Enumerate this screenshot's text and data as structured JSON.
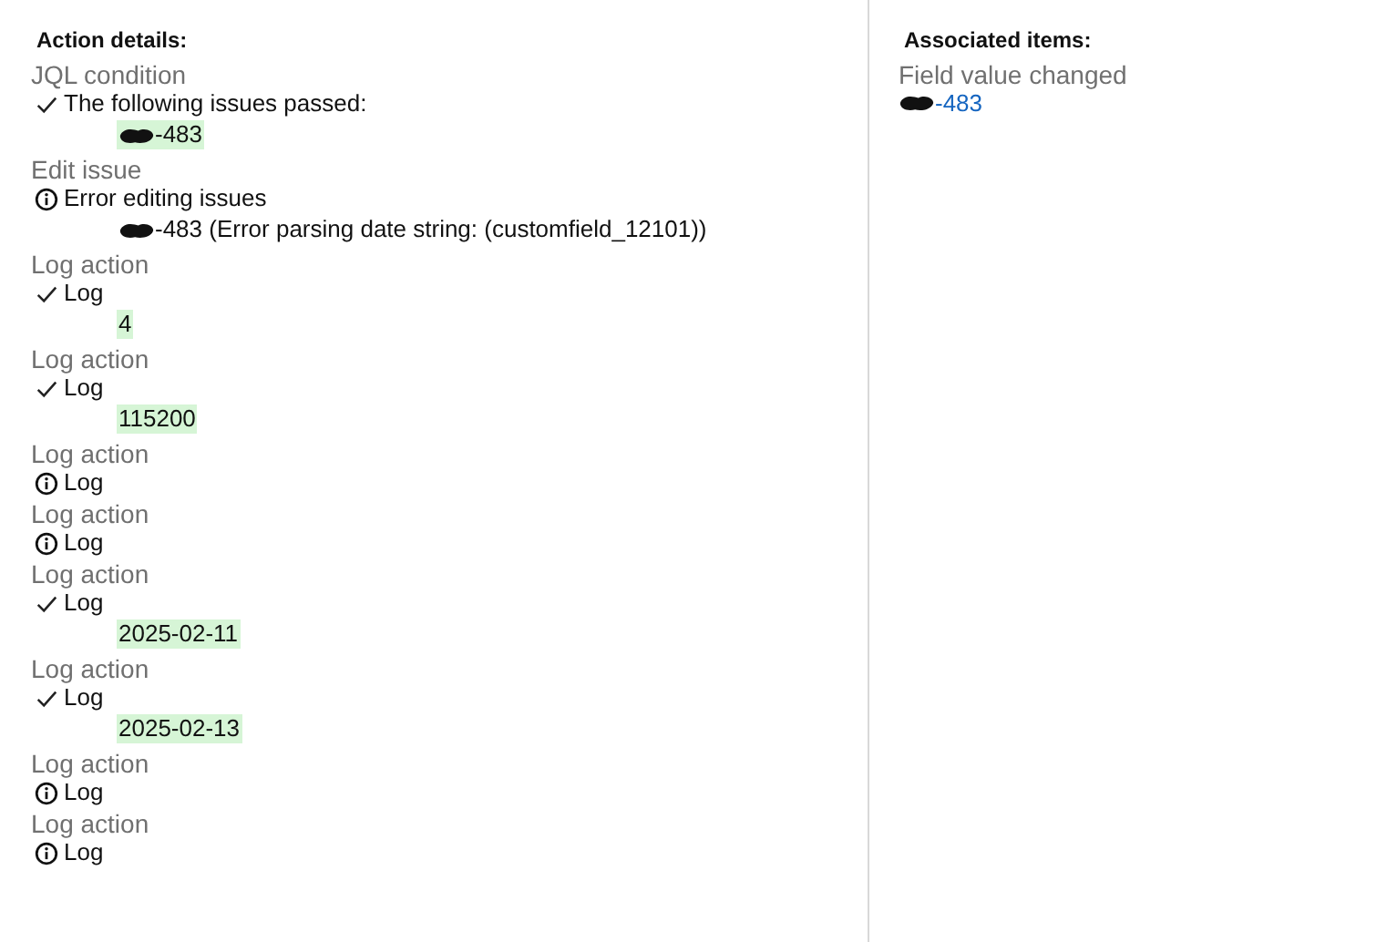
{
  "action_details": {
    "heading": "Action details:",
    "actions": [
      {
        "title": "JQL condition",
        "kind": "success",
        "message": "The following issues passed:",
        "details": [
          {
            "text": "-483",
            "redacted": true,
            "highlighted": true
          }
        ]
      },
      {
        "title": "Edit issue",
        "kind": "info",
        "message": "Error editing issues",
        "details": [
          {
            "text": "-483 (Error parsing date string: (customfield_12101))",
            "redacted": true,
            "highlighted": false
          }
        ]
      },
      {
        "title": "Log action",
        "kind": "success",
        "message": "Log",
        "details": [
          {
            "text": "4",
            "redacted": false,
            "highlighted": true
          }
        ]
      },
      {
        "title": "Log action",
        "kind": "success",
        "message": "Log",
        "details": [
          {
            "text": "115200",
            "redacted": false,
            "highlighted": true
          }
        ]
      },
      {
        "title": "Log action",
        "kind": "info",
        "message": "Log"
      },
      {
        "title": "Log action",
        "kind": "info",
        "message": "Log"
      },
      {
        "title": "Log action",
        "kind": "success",
        "message": "Log",
        "details": [
          {
            "text": "2025-02-11",
            "redacted": false,
            "highlighted": true
          }
        ]
      },
      {
        "title": "Log action",
        "kind": "success",
        "message": "Log",
        "details": [
          {
            "text": "2025-02-13",
            "redacted": false,
            "highlighted": true
          }
        ]
      },
      {
        "title": "Log action",
        "kind": "info",
        "message": "Log"
      },
      {
        "title": "Log action",
        "kind": "info",
        "message": "Log"
      }
    ]
  },
  "associated_items": {
    "heading": "Associated items:",
    "groups": [
      {
        "title": "Field value changed",
        "links": [
          {
            "text": "-483",
            "redacted": true
          }
        ]
      }
    ]
  }
}
